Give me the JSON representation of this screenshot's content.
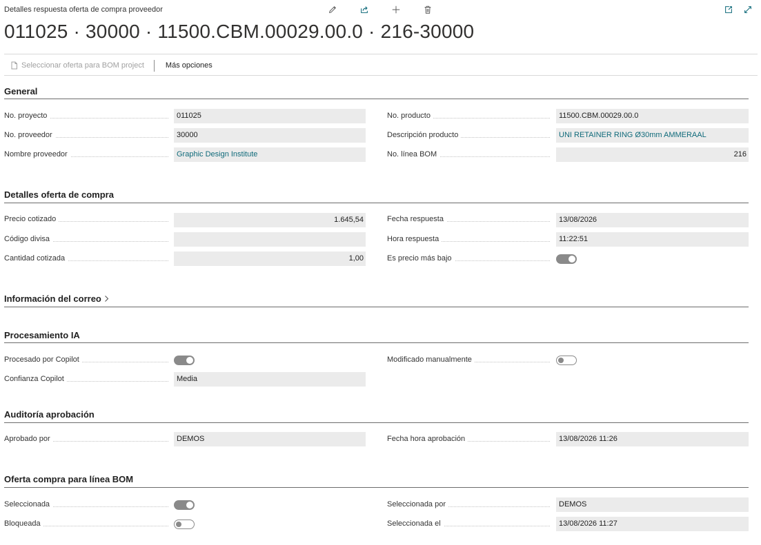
{
  "page": {
    "caption": "Detalles respuesta oferta de compra proveedor",
    "title": "011025 · 30000 · 11500.CBM.00029.00.0 · 216-30000"
  },
  "header_icons": {
    "edit": "pencil-icon",
    "share": "share-icon",
    "new": "plus-icon",
    "delete": "trash-icon",
    "open_new_window": "open-new-window-icon",
    "expand": "expand-icon"
  },
  "actions": {
    "select_offer": "Seleccionar oferta para BOM project",
    "more_options": "Más opciones"
  },
  "sections": {
    "general": {
      "title": "General",
      "no_proyecto": {
        "label": "No. proyecto",
        "value": "011025"
      },
      "no_proveedor": {
        "label": "No. proveedor",
        "value": "30000"
      },
      "nombre_proveedor": {
        "label": "Nombre proveedor",
        "value": "Graphic Design Institute"
      },
      "no_producto": {
        "label": "No. producto",
        "value": "11500.CBM.00029.00.0"
      },
      "descripcion_producto": {
        "label": "Descripción producto",
        "value": "UNI RETAINER RING Ø30mm AMMERAAL"
      },
      "no_linea_bom": {
        "label": "No. línea BOM",
        "value": "216"
      }
    },
    "detalles": {
      "title": "Detalles oferta de compra",
      "precio_cotizado": {
        "label": "Precio cotizado",
        "value": "1.645,54"
      },
      "codigo_divisa": {
        "label": "Código divisa",
        "value": ""
      },
      "cantidad_cotizada": {
        "label": "Cantidad cotizada",
        "value": "1,00"
      },
      "fecha_respuesta": {
        "label": "Fecha respuesta",
        "value": "13/08/2026"
      },
      "hora_respuesta": {
        "label": "Hora respuesta",
        "value": "11:22:51"
      },
      "es_precio_mas_bajo": {
        "label": "Es precio más bajo",
        "value": true
      }
    },
    "correo": {
      "title": "Información del correo"
    },
    "procesamiento": {
      "title": "Procesamiento IA",
      "procesado_copilot": {
        "label": "Procesado por Copilot",
        "value": true
      },
      "confianza_copilot": {
        "label": "Confianza Copilot",
        "value": "Media"
      },
      "modificado_manualmente": {
        "label": "Modificado manualmente",
        "value": false
      }
    },
    "auditoria": {
      "title": "Auditoría aprobación",
      "aprobado_por": {
        "label": "Aprobado por",
        "value": "DEMOS"
      },
      "fecha_hora_aprobacion": {
        "label": "Fecha hora aprobación",
        "value": "13/08/2026 11:26"
      }
    },
    "oferta_bom": {
      "title": "Oferta compra para línea BOM",
      "seleccionada": {
        "label": "Seleccionada",
        "value": true
      },
      "bloqueada": {
        "label": "Bloqueada",
        "value": false
      },
      "seleccionada_por": {
        "label": "Seleccionada por",
        "value": "DEMOS"
      },
      "seleccionada_el": {
        "label": "Seleccionada el",
        "value": "13/08/2026 11:27"
      }
    }
  }
}
